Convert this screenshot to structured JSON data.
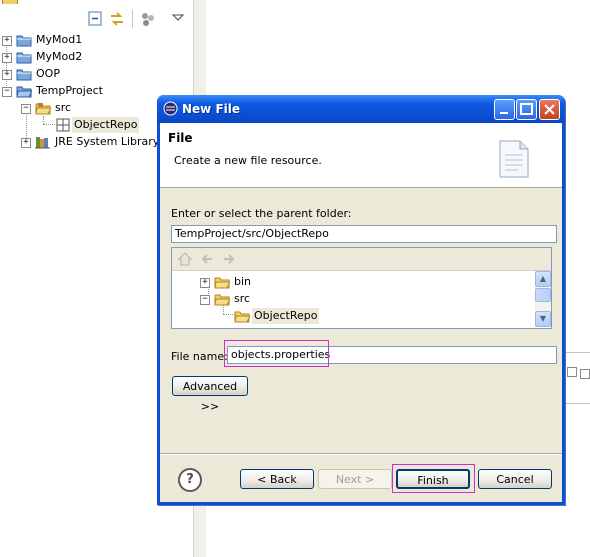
{
  "explorer": {
    "items": [
      {
        "label": "MyMod1",
        "expander": "+"
      },
      {
        "label": "MyMod2",
        "expander": "+"
      },
      {
        "label": "OOP",
        "expander": "+"
      },
      {
        "label": "TempProject",
        "expander": "−"
      },
      {
        "label": "src",
        "expander": "−"
      },
      {
        "label": "ObjectRepo",
        "expander": ""
      },
      {
        "label": "JRE System Library [",
        "expander": "+"
      }
    ],
    "selected": "ObjectRepo",
    "toolbar_icons": [
      "collapse-all-icon",
      "link-with-editor-icon",
      "view-menu-icon"
    ]
  },
  "dialog": {
    "title": "New File",
    "header_title": "File",
    "header_description": "Create a new file resource.",
    "parent_label": "Enter or select the parent folder:",
    "parent_value": "TempProject/src/ObjectRepo",
    "tree_items": [
      {
        "label": "bin",
        "expander": "+"
      },
      {
        "label": "src",
        "expander": "−"
      },
      {
        "label": "ObjectRepo",
        "expander": ""
      }
    ],
    "tree_selected": "ObjectRepo",
    "filename_label": "File name:",
    "filename_value": "objects.properties",
    "advanced_label": "Advanced >>",
    "help_label": "?",
    "buttons": {
      "back": "< Back",
      "next": "Next >",
      "finish": "Finish",
      "cancel": "Cancel"
    },
    "colors": {
      "title_bar": "#0a4fd6",
      "highlight": "#d02fd0",
      "dialog_background": "#ece9d8"
    }
  }
}
